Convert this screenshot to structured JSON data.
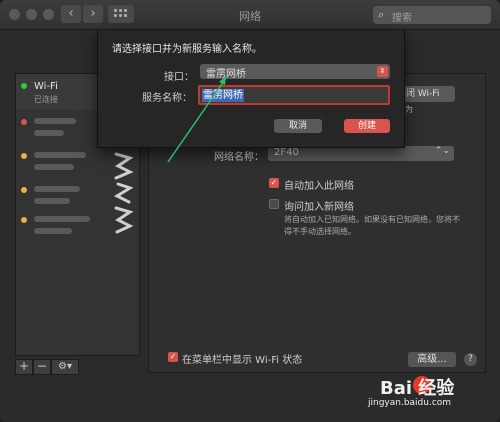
{
  "window": {
    "title": "网络",
    "search_placeholder": "搜索"
  },
  "sidebar": {
    "items": [
      {
        "label": "Wi-Fi",
        "status": "已连接",
        "status_color": "#2ecc40"
      },
      {
        "label": "",
        "status": "",
        "status_color": "#d9534f"
      },
      {
        "label": "",
        "status": "",
        "status_color": "#f0ad4e"
      },
      {
        "label": "",
        "status": "",
        "status_color": "#f0ad4e"
      },
      {
        "label": "",
        "status": "",
        "status_color": "#f0ad4e"
      }
    ],
    "footer": {
      "add": "+",
      "remove": "−",
      "gear": "⚙▾"
    }
  },
  "sheet": {
    "prompt": "请选择接口并为新服务输入名称。",
    "interface_label": "接口：",
    "interface_value": "雷雳网桥",
    "service_label": "服务名称：",
    "service_value": "雷雳网桥",
    "cancel": "取消",
    "create": "创建"
  },
  "panel": {
    "wifi_button": "闭 Wi-Fi",
    "fragment": "为",
    "network_name_label": "网络名称：",
    "network_name_value": "2F40",
    "auto_join": "自动加入此网络",
    "ask_join": "询问加入新网络",
    "help_text_1": "将自动加入已知网络。如果没有已知网络，您将不",
    "help_text_2": "得不手动选择网络。",
    "show_menu": "在菜单栏中显示 Wi-Fi 状态",
    "advanced": "高级...",
    "help": "?"
  },
  "watermark": {
    "brand": "Bai 经验",
    "url": "jingyan.baidu.com"
  },
  "colors": {
    "accent_red": "#d9534f",
    "selection": "#3d6ab7",
    "arrow": "#27c06a"
  }
}
